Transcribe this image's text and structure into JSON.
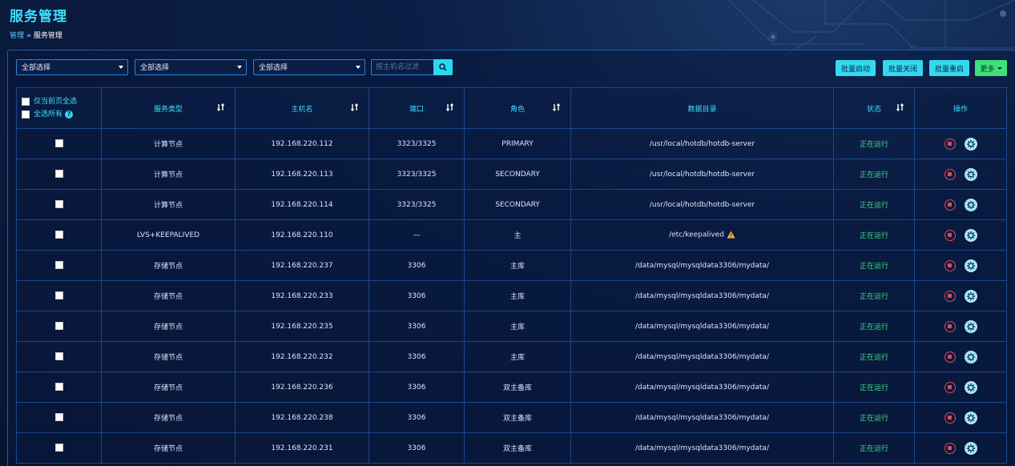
{
  "page": {
    "title": "服务管理",
    "breadcrumb": {
      "home": "管理",
      "separator": "»",
      "current": "服务管理"
    }
  },
  "toolbar": {
    "filters": [
      {
        "value": "全部选择"
      },
      {
        "value": "全部选择"
      },
      {
        "value": "全部选择"
      }
    ],
    "search_placeholder": "按主机名过滤",
    "batch_start": "批量启动",
    "batch_stop": "批量关闭",
    "batch_restart": "批量重启",
    "more": "更多"
  },
  "table": {
    "select_page": "仅当前页全选",
    "select_all": "全选所有",
    "headers": {
      "service_type": "服务类型",
      "hostname": "主机名",
      "port": "端口",
      "role": "角色",
      "data_dir": "数据目录",
      "status": "状态",
      "ops": "操作"
    },
    "rows": [
      {
        "type": "计算节点",
        "host": "192.168.220.112",
        "port": "3323/3325",
        "role": "PRIMARY",
        "dir": "/usr/local/hotdb/hotdb-server",
        "status": "正在运行",
        "warn": false
      },
      {
        "type": "计算节点",
        "host": "192.168.220.113",
        "port": "3323/3325",
        "role": "SECONDARY",
        "dir": "/usr/local/hotdb/hotdb-server",
        "status": "正在运行",
        "warn": false
      },
      {
        "type": "计算节点",
        "host": "192.168.220.114",
        "port": "3323/3325",
        "role": "SECONDARY",
        "dir": "/usr/local/hotdb/hotdb-server",
        "status": "正在运行",
        "warn": false
      },
      {
        "type": "LVS+KEEPALIVED",
        "host": "192.168.220.110",
        "port": "—",
        "role": "主",
        "dir": "/etc/keepalived",
        "status": "正在运行",
        "warn": true
      },
      {
        "type": "存储节点",
        "host": "192.168.220.237",
        "port": "3306",
        "role": "主库",
        "dir": "/data/mysql/mysqldata3306/mydata/",
        "status": "正在运行",
        "warn": false
      },
      {
        "type": "存储节点",
        "host": "192.168.220.233",
        "port": "3306",
        "role": "主库",
        "dir": "/data/mysql/mysqldata3306/mydata/",
        "status": "正在运行",
        "warn": false
      },
      {
        "type": "存储节点",
        "host": "192.168.220.235",
        "port": "3306",
        "role": "主库",
        "dir": "/data/mysql/mysqldata3306/mydata/",
        "status": "正在运行",
        "warn": false
      },
      {
        "type": "存储节点",
        "host": "192.168.220.232",
        "port": "3306",
        "role": "主库",
        "dir": "/data/mysql/mysqldata3306/mydata/",
        "status": "正在运行",
        "warn": false
      },
      {
        "type": "存储节点",
        "host": "192.168.220.236",
        "port": "3306",
        "role": "双主备库",
        "dir": "/data/mysql/mysqldata3306/mydata/",
        "status": "正在运行",
        "warn": false
      },
      {
        "type": "存储节点",
        "host": "192.168.220.238",
        "port": "3306",
        "role": "双主备库",
        "dir": "/data/mysql/mysqldata3306/mydata/",
        "status": "正在运行",
        "warn": false
      },
      {
        "type": "存储节点",
        "host": "192.168.220.231",
        "port": "3306",
        "role": "双主备库",
        "dir": "/data/mysql/mysqldata3306/mydata/",
        "status": "正在运行",
        "warn": false
      }
    ]
  }
}
